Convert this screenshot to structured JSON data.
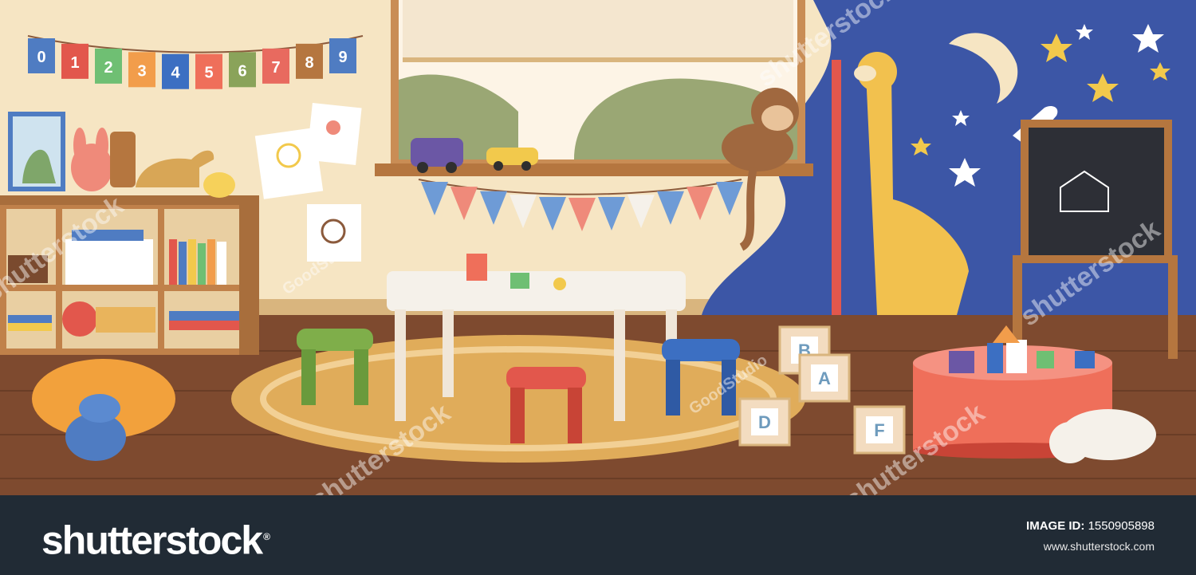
{
  "footer": {
    "logo_text": "shutterstock",
    "image_id_label": "IMAGE ID:",
    "image_id_value": "1550905898",
    "site_url": "www.shutterstock.com"
  },
  "watermarks": {
    "brand": "shutterstock",
    "author": "GoodStudio"
  },
  "bunting_digits": [
    "0",
    "1",
    "2",
    "3",
    "4",
    "5",
    "6",
    "7",
    "8",
    "9"
  ],
  "blocks": [
    "B",
    "A",
    "D",
    "F"
  ],
  "colors": {
    "wall": "#f6e5c3",
    "night_wall": "#3c56a6",
    "floor": "#7e4a2f",
    "footer": "#212b35"
  }
}
